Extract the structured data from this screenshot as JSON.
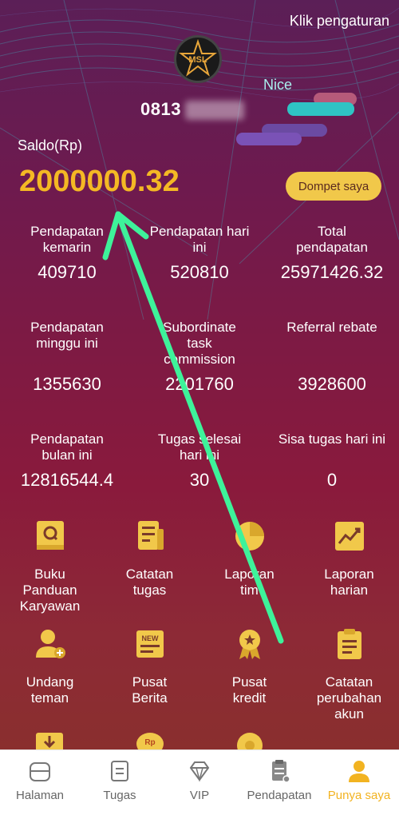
{
  "header": {
    "settings_link": "Klik pengaturan",
    "phone": "0813",
    "badge": "Nice"
  },
  "balance": {
    "label": "Saldo(Rp)",
    "value": "2000000.32",
    "wallet_button": "Dompet saya"
  },
  "stats": [
    {
      "label": "Pendapatan kemarin",
      "value": "409710"
    },
    {
      "label": "Pendapatan hari ini",
      "value": "520810"
    },
    {
      "label": "Total pendapatan",
      "value": "25971426.32"
    },
    {
      "label": "Pendapatan minggu ini",
      "value": "1355630"
    },
    {
      "label": "Subordinate task commission",
      "value": "2201760"
    },
    {
      "label": "Referral rebate",
      "value": "3928600"
    },
    {
      "label": "Pendapatan bulan ini",
      "value": "12816544.4"
    },
    {
      "label": "Tugas selesai hari ini",
      "value": "30"
    },
    {
      "label": "Sisa tugas hari ini",
      "value": "0"
    }
  ],
  "menu": [
    {
      "label": "Buku Panduan Karyawan",
      "icon": "handbook-icon"
    },
    {
      "label": "Catatan tugas",
      "icon": "task-record-icon"
    },
    {
      "label": "Laporan tim",
      "icon": "pie-chart-icon"
    },
    {
      "label": "Laporan harian",
      "icon": "line-chart-icon"
    },
    {
      "label": "Undang teman",
      "icon": "invite-user-icon"
    },
    {
      "label": "Pusat Berita",
      "icon": "news-icon"
    },
    {
      "label": "Pusat kredit",
      "icon": "medal-icon"
    },
    {
      "label": "Catatan perubahan akun",
      "icon": "clipboard-icon"
    }
  ],
  "menu_partial": {
    "coin_label": "Rp"
  },
  "nav": [
    {
      "label": "Halaman",
      "icon": "home-icon"
    },
    {
      "label": "Tugas",
      "icon": "task-icon"
    },
    {
      "label": "VIP",
      "icon": "diamond-icon"
    },
    {
      "label": "Pendapatan",
      "icon": "income-icon"
    },
    {
      "label": "Punya saya",
      "icon": "profile-icon",
      "active": true
    }
  ],
  "colors": {
    "accent": "#f2b321",
    "arrow": "#3ef29a",
    "balance": "#f4b824"
  }
}
